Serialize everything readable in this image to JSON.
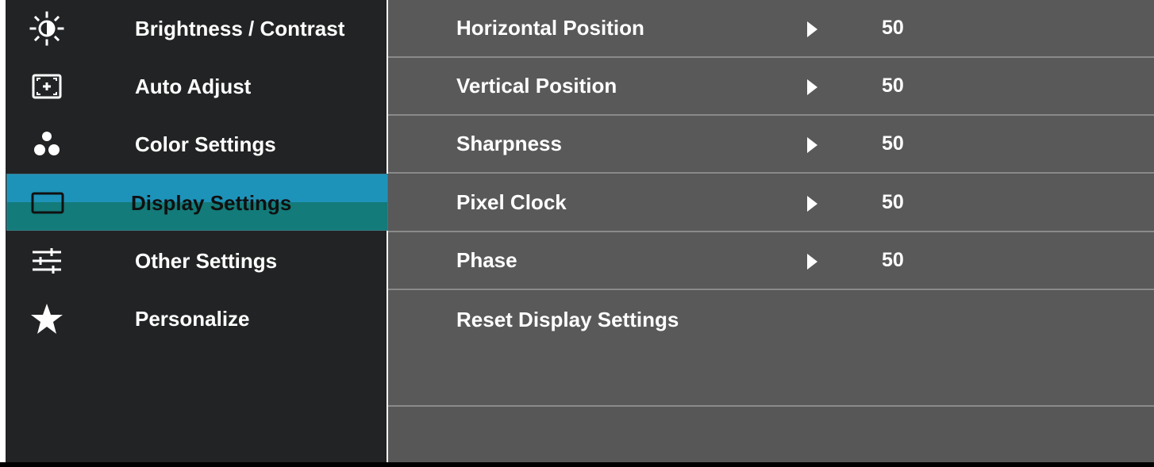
{
  "menu": {
    "items": [
      {
        "label": "Brightness / Contrast",
        "icon": "brightness-icon"
      },
      {
        "label": "Auto Adjust",
        "icon": "auto-adjust-icon"
      },
      {
        "label": "Color Settings",
        "icon": "color-dots-icon"
      },
      {
        "label": "Display Settings",
        "icon": "display-icon",
        "selected": true
      },
      {
        "label": "Other Settings",
        "icon": "sliders-icon"
      },
      {
        "label": "Personalize",
        "icon": "star-icon"
      }
    ]
  },
  "display_settings": {
    "rows": [
      {
        "label": "Horizontal Position",
        "value": "50"
      },
      {
        "label": "Vertical Position",
        "value": "50"
      },
      {
        "label": "Sharpness",
        "value": "50"
      },
      {
        "label": "Pixel Clock",
        "value": "50"
      },
      {
        "label": "Phase",
        "value": "50"
      }
    ],
    "reset_label": "Reset Display Settings"
  },
  "colors": {
    "sidebar_bg": "#222324",
    "content_bg": "#595959",
    "selected_top": "#1e93b9",
    "selected_bottom": "#137b7a",
    "divider": "#8a8a8a"
  }
}
